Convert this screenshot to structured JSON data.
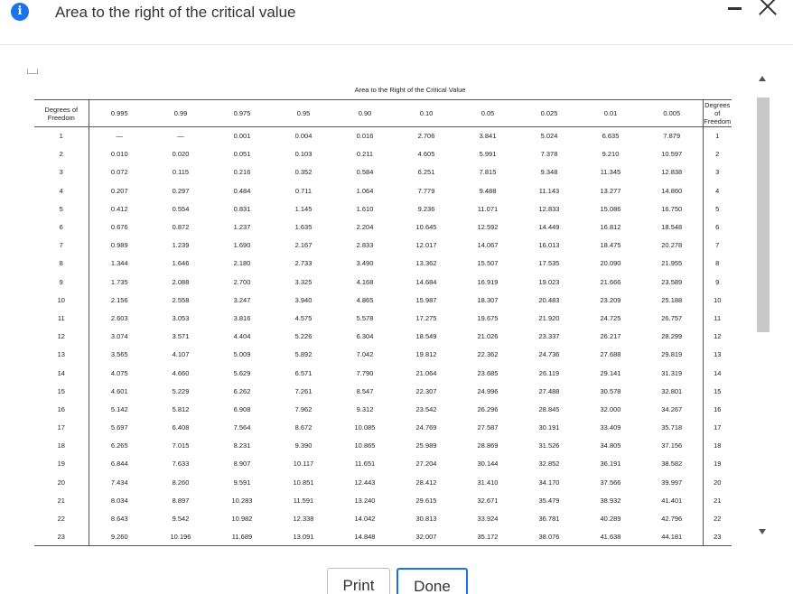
{
  "dialog": {
    "title": "Area to the right of the critical value",
    "info_icon_glyph": "i",
    "accent_color": "#1a73e8"
  },
  "table": {
    "caption": "Area to the Right of the Critical Value",
    "df_header": "Degrees of Freedom",
    "columns": [
      "0.995",
      "0.99",
      "0.975",
      "0.95",
      "0.90",
      "0.10",
      "0.05",
      "0.025",
      "0.01",
      "0.005"
    ],
    "rows": [
      {
        "df": "1",
        "v": [
          "—",
          "—",
          "0.001",
          "0.004",
          "0.016",
          "2.706",
          "3.841",
          "5.024",
          "6.635",
          "7.879"
        ]
      },
      {
        "df": "2",
        "v": [
          "0.010",
          "0.020",
          "0.051",
          "0.103",
          "0.211",
          "4.605",
          "5.991",
          "7.378",
          "9.210",
          "10.597"
        ]
      },
      {
        "df": "3",
        "v": [
          "0.072",
          "0.115",
          "0.216",
          "0.352",
          "0.584",
          "6.251",
          "7.815",
          "9.348",
          "11.345",
          "12.838"
        ]
      },
      {
        "df": "4",
        "v": [
          "0.207",
          "0.297",
          "0.484",
          "0.711",
          "1.064",
          "7.779",
          "9.488",
          "11.143",
          "13.277",
          "14.860"
        ]
      },
      {
        "df": "5",
        "v": [
          "0.412",
          "0.554",
          "0.831",
          "1.145",
          "1.610",
          "9.236",
          "11.071",
          "12.833",
          "15.086",
          "16.750"
        ]
      },
      {
        "df": "6",
        "v": [
          "0.676",
          "0.872",
          "1.237",
          "1.635",
          "2.204",
          "10.645",
          "12.592",
          "14.449",
          "16.812",
          "18.548"
        ]
      },
      {
        "df": "7",
        "v": [
          "0.989",
          "1.239",
          "1.690",
          "2.167",
          "2.833",
          "12.017",
          "14.067",
          "16.013",
          "18.475",
          "20.278"
        ]
      },
      {
        "df": "8",
        "v": [
          "1.344",
          "1.646",
          "2.180",
          "2.733",
          "3.490",
          "13.362",
          "15.507",
          "17.535",
          "20.090",
          "21.955"
        ]
      },
      {
        "df": "9",
        "v": [
          "1.735",
          "2.088",
          "2.700",
          "3.325",
          "4.168",
          "14.684",
          "16.919",
          "19.023",
          "21.666",
          "23.589"
        ]
      },
      {
        "df": "10",
        "v": [
          "2.156",
          "2.558",
          "3.247",
          "3.940",
          "4.865",
          "15.987",
          "18.307",
          "20.483",
          "23.209",
          "25.188"
        ]
      },
      {
        "df": "11",
        "v": [
          "2.603",
          "3.053",
          "3.816",
          "4.575",
          "5.578",
          "17.275",
          "19.675",
          "21.920",
          "24.725",
          "26.757"
        ]
      },
      {
        "df": "12",
        "v": [
          "3.074",
          "3.571",
          "4.404",
          "5.226",
          "6.304",
          "18.549",
          "21.026",
          "23.337",
          "26.217",
          "28.299"
        ]
      },
      {
        "df": "13",
        "v": [
          "3.565",
          "4.107",
          "5.009",
          "5.892",
          "7.042",
          "19.812",
          "22.362",
          "24.736",
          "27.688",
          "29.819"
        ]
      },
      {
        "df": "14",
        "v": [
          "4.075",
          "4.660",
          "5.629",
          "6.571",
          "7.790",
          "21.064",
          "23.685",
          "26.119",
          "29.141",
          "31.319"
        ]
      },
      {
        "df": "15",
        "v": [
          "4.601",
          "5.229",
          "6.262",
          "7.261",
          "8.547",
          "22.307",
          "24.996",
          "27.488",
          "30.578",
          "32.801"
        ]
      },
      {
        "df": "16",
        "v": [
          "5.142",
          "5.812",
          "6.908",
          "7.962",
          "9.312",
          "23.542",
          "26.296",
          "28.845",
          "32.000",
          "34.267"
        ]
      },
      {
        "df": "17",
        "v": [
          "5.697",
          "6.408",
          "7.564",
          "8.672",
          "10.085",
          "24.769",
          "27.587",
          "30.191",
          "33.409",
          "35.718"
        ]
      },
      {
        "df": "18",
        "v": [
          "6.265",
          "7.015",
          "8.231",
          "9.390",
          "10.865",
          "25.989",
          "28.869",
          "31.526",
          "34.805",
          "37.156"
        ]
      },
      {
        "df": "19",
        "v": [
          "6.844",
          "7.633",
          "8.907",
          "10.117",
          "11.651",
          "27.204",
          "30.144",
          "32.852",
          "36.191",
          "38.582"
        ]
      },
      {
        "df": "20",
        "v": [
          "7.434",
          "8.260",
          "9.591",
          "10.851",
          "12.443",
          "28.412",
          "31.410",
          "34.170",
          "37.566",
          "39.997"
        ]
      },
      {
        "df": "21",
        "v": [
          "8.034",
          "8.897",
          "10.283",
          "11.591",
          "13.240",
          "29.615",
          "32.671",
          "35.479",
          "38.932",
          "41.401"
        ]
      },
      {
        "df": "22",
        "v": [
          "8.643",
          "9.542",
          "10.982",
          "12.338",
          "14.042",
          "30.813",
          "33.924",
          "36.781",
          "40.289",
          "42.796"
        ]
      },
      {
        "df": "23",
        "v": [
          "9.260",
          "10.196",
          "11.689",
          "13.091",
          "14.848",
          "32.007",
          "35.172",
          "38.076",
          "41.638",
          "44.181"
        ]
      }
    ]
  },
  "buttons": {
    "print_label": "Print",
    "done_label": "Done"
  }
}
